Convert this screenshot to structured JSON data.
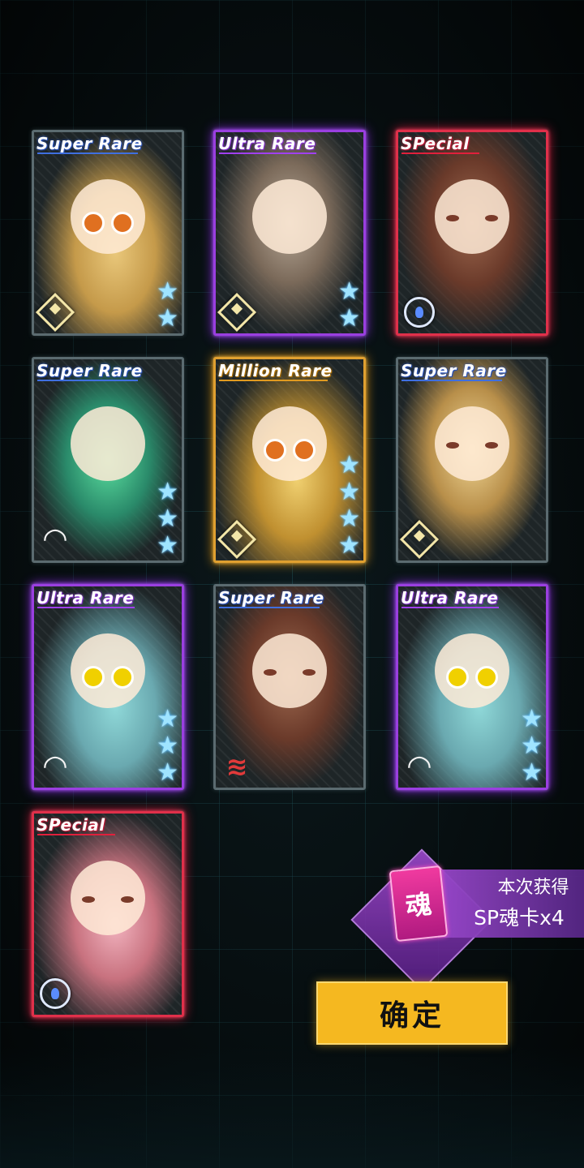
{
  "cards": [
    {
      "rarity": "Super Rare",
      "tier": "sr",
      "stars": 2,
      "emblem": "diamond",
      "art": "sr",
      "eyes": "orange"
    },
    {
      "rarity": "Ultra Rare",
      "tier": "ur",
      "stars": 2,
      "emblem": "diamond",
      "art": "grey",
      "eyes": "none"
    },
    {
      "rarity": "SPecial",
      "tier": "sp",
      "stars": 0,
      "emblem": "circle",
      "art": "brown",
      "eyes": "small"
    },
    {
      "rarity": "Super Rare",
      "tier": "sr",
      "stars": 3,
      "emblem": "wifi",
      "art": "green",
      "eyes": "none"
    },
    {
      "rarity": "Million Rare",
      "tier": "mr",
      "stars": 4,
      "emblem": "diamond",
      "art": "mr",
      "eyes": "orange"
    },
    {
      "rarity": "Super Rare",
      "tier": "sr",
      "stars": 0,
      "emblem": "diamond",
      "art": "blonde",
      "eyes": "small"
    },
    {
      "rarity": "Ultra Rare",
      "tier": "ur",
      "stars": 3,
      "emblem": "wifi",
      "art": "ur",
      "eyes": "yellow"
    },
    {
      "rarity": "Super Rare",
      "tier": "sr",
      "stars": 0,
      "emblem": "stripes",
      "art": "brown",
      "eyes": "small"
    },
    {
      "rarity": "Ultra Rare",
      "tier": "ur",
      "stars": 3,
      "emblem": "wifi",
      "art": "ur",
      "eyes": "yellow"
    },
    {
      "rarity": "SPecial",
      "tier": "sp",
      "stars": 0,
      "emblem": "circle",
      "art": "sp",
      "eyes": "small"
    }
  ],
  "reward": {
    "icon_char": "魂",
    "label": "本次获得",
    "count": "SP魂卡x4"
  },
  "confirm_label": "确定",
  "colors": {
    "super_rare": "#3f6fe0",
    "ultra_rare": "#a040f0",
    "special": "#e0203c",
    "million_rare": "#e09a20",
    "confirm": "#f5b820"
  }
}
